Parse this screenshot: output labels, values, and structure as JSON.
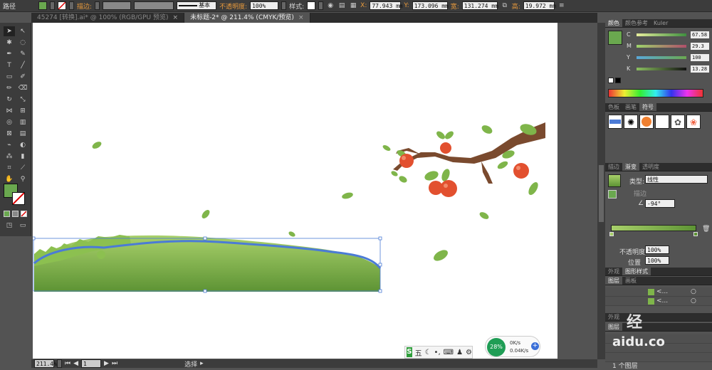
{
  "control_bar": {
    "object_label": "路径",
    "stroke_label": "描边:",
    "stroke_style": "基本",
    "opacity_label": "不透明度:",
    "opacity_value": "100%",
    "style_label": "样式:",
    "x_label": "X:",
    "x_value": "77.943 mm",
    "y_label": "Y:",
    "y_value": "173.096 mm",
    "w_label": "宽:",
    "w_value": "131.274 mm",
    "h_label": "高:",
    "h_value": "19.972 mm"
  },
  "tabs": [
    {
      "label": "45274 [转换].ai* @ 100% (RGB/GPU 预览)",
      "close": "×"
    },
    {
      "label": "未标题-2* @ 211.4% (CMYK/预览)",
      "close": "×"
    }
  ],
  "color_panel": {
    "tabs": [
      "颜色",
      "颜色参考",
      "Kuler"
    ],
    "channels": [
      {
        "label": "C",
        "value": "67.58",
        "pos": 0.68
      },
      {
        "label": "M",
        "value": "29.3",
        "pos": 0.29
      },
      {
        "label": "Y",
        "value": "100",
        "pos": 1.0
      },
      {
        "label": "K",
        "value": "13.28",
        "pos": 0.13
      }
    ]
  },
  "symbols_panel": {
    "tabs": [
      "色板",
      "画笔",
      "符号"
    ]
  },
  "gradient_panel": {
    "tabs": [
      "描边",
      "渐变",
      "透明度"
    ],
    "type_label": "类型:",
    "type_value": "线性",
    "stroke_label": "描边",
    "angle_value": "-94°",
    "opacity_label": "不透明度",
    "opacity_value": "100%",
    "position_label": "位置",
    "position_value": "100%"
  },
  "appearance_panel": {
    "tabs": [
      "外观",
      "图形样式"
    ]
  },
  "layers_panel": {
    "tabs": [
      "图层",
      "画板"
    ],
    "rows": [
      "<...",
      "<..."
    ],
    "footer": "1 个图层"
  },
  "layers_panel2": {
    "tabs": [
      "外观",
      "图层"
    ]
  },
  "status_bar": {
    "zoom": "211.4%",
    "page": "1",
    "tool": "选择"
  },
  "ime_bar": {
    "logo": "S",
    "mode": "五"
  },
  "net_widget": {
    "percent": "28%",
    "up": "0K/s",
    "down": "0.04K/s"
  },
  "watermark": {
    "text": "aidu.co"
  },
  "colors": {
    "fill": "#6aa84f",
    "grass_top": "#a8d06a",
    "grass_bottom": "#5d9334",
    "leaf": "#7fb54a",
    "branch": "#7a4a2e",
    "fruit": "#e2502f",
    "selection": "#4b7bd6"
  }
}
